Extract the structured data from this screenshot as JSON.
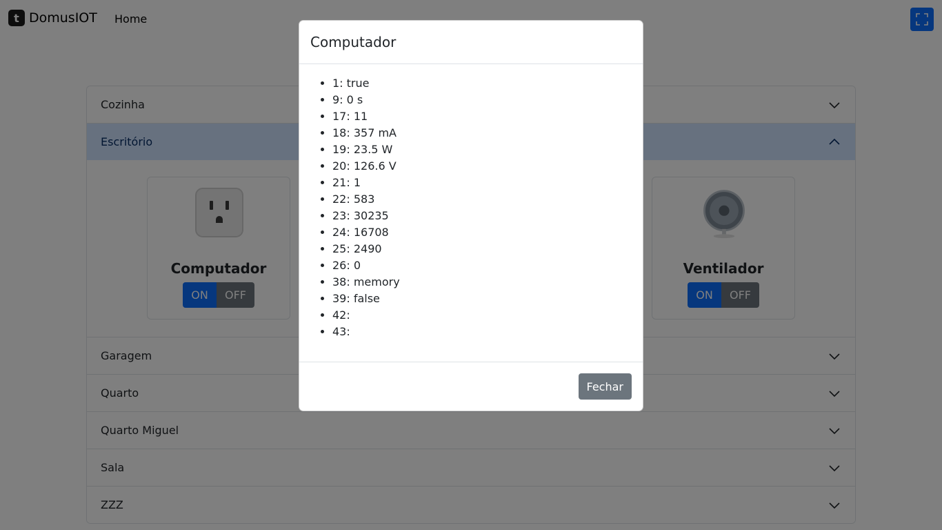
{
  "navbar": {
    "brand": "DomusIOT",
    "brand_logo": "t",
    "home": "Home"
  },
  "accordion": [
    {
      "label": "Cozinha",
      "open": false
    },
    {
      "label": "Escritório",
      "open": true
    },
    {
      "label": "Garagem",
      "open": false
    },
    {
      "label": "Quarto",
      "open": false
    },
    {
      "label": "Quarto Miguel",
      "open": false
    },
    {
      "label": "Sala",
      "open": false
    },
    {
      "label": "ZZZ",
      "open": false
    }
  ],
  "devices": [
    {
      "name": "Computador",
      "icon": "power-outlet-icon",
      "on_label": "ON",
      "off_label": "OFF"
    },
    {
      "name": "Ventilador",
      "icon": "fan-icon",
      "on_label": "ON",
      "off_label": "OFF"
    }
  ],
  "modal": {
    "title": "Computador",
    "items": [
      "1: true",
      "9: 0 s",
      "17: 11",
      "18: 357 mA",
      "19: 23.5 W",
      "20: 126.6 V",
      "21: 1",
      "22: 583",
      "23: 30235",
      "24: 16708",
      "25: 2490",
      "26: 0",
      "38: memory",
      "39: false",
      "42:",
      "43:"
    ],
    "close_label": "Fechar"
  },
  "colors": {
    "primary": "#0d6efd",
    "secondary": "#6c757d",
    "accordion_open_bg": "#cfe2ff"
  }
}
